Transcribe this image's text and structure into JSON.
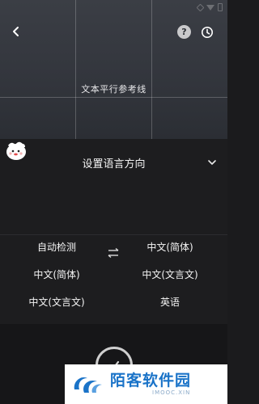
{
  "camera": {
    "guide_label": "文本平行参考线",
    "icons": {
      "back": "back-arrow-icon",
      "help": "help-icon",
      "history": "clock-icon"
    },
    "help_glyph": "?"
  },
  "language_panel": {
    "title": "设置语言方向",
    "collapse_icon": "chevron-down-icon",
    "rows": [
      {
        "left": "自动检测",
        "right": "中文(简体)"
      },
      {
        "left": "中文(简体)",
        "right": "中文(文言文)"
      },
      {
        "left": "中文(文言文)",
        "right": "英语"
      }
    ],
    "swap_icon": "swap-arrows-icon"
  },
  "watermark": {
    "title": "陌客软件园",
    "subtitle": "IMOOC.XIN"
  },
  "colors": {
    "panel_bg": "#1d1d1f",
    "watermark_blue": "#1a73c8"
  }
}
